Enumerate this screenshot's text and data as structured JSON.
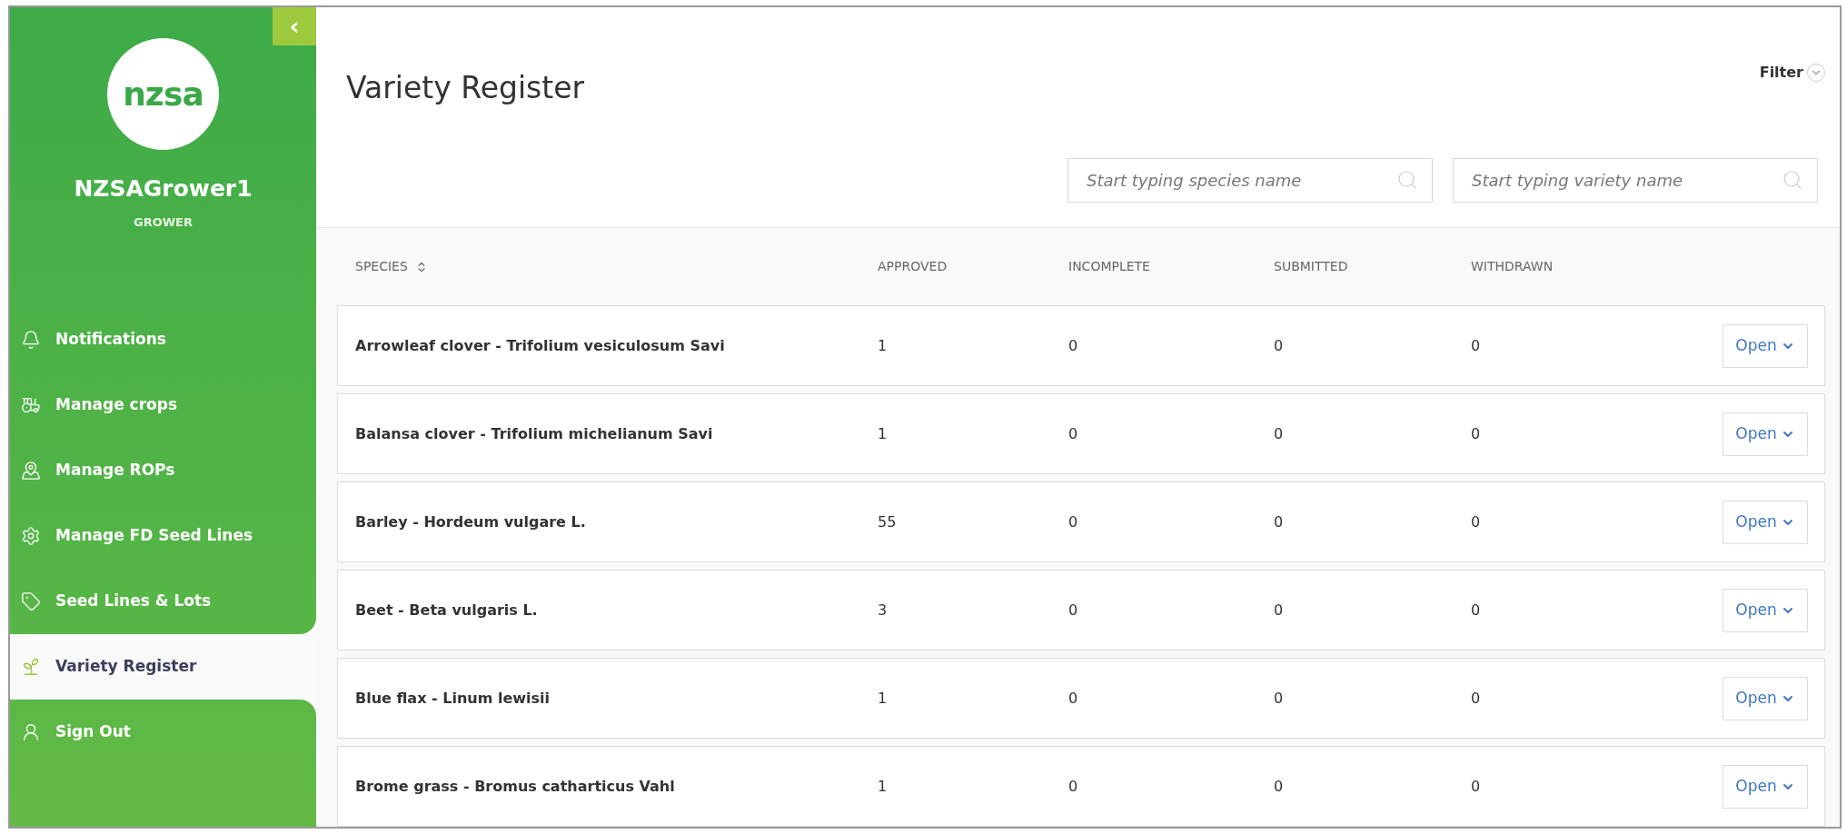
{
  "sidebar": {
    "logo_text": "nzsa",
    "user_name": "NZSAGrower1",
    "role": "GROWER",
    "collapse_glyph": "‹",
    "items": [
      {
        "label": "Notifications",
        "selected": false
      },
      {
        "label": "Manage crops",
        "selected": false
      },
      {
        "label": "Manage ROPs",
        "selected": false
      },
      {
        "label": "Manage FD Seed Lines",
        "selected": false
      },
      {
        "label": "Seed Lines & Lots",
        "selected": false
      },
      {
        "label": "Variety Register",
        "selected": true
      },
      {
        "label": "Sign Out",
        "selected": false
      }
    ]
  },
  "page": {
    "title": "Variety Register",
    "filter": "Filter",
    "searches": [
      {
        "placeholder": "Start typing species name"
      },
      {
        "placeholder": "Start typing variety name"
      }
    ]
  },
  "table": {
    "columns": [
      "SPECIES",
      "APPROVED",
      "INCOMPLETE",
      "SUBMITTED",
      "WITHDRAWN"
    ],
    "rows": [
      {
        "species": "Arrowleaf clover - Trifolium vesiculosum Savi",
        "approved": "1",
        "incomplete": "0",
        "submitted": "0",
        "withdrawn": "0",
        "action": "Open"
      },
      {
        "species": "Balansa clover - Trifolium michelianum Savi",
        "approved": "1",
        "incomplete": "0",
        "submitted": "0",
        "withdrawn": "0",
        "action": "Open"
      },
      {
        "species": "Barley - Hordeum vulgare L.",
        "approved": "55",
        "incomplete": "0",
        "submitted": "0",
        "withdrawn": "0",
        "action": "Open"
      },
      {
        "species": "Beet - Beta vulgaris L.",
        "approved": "3",
        "incomplete": "0",
        "submitted": "0",
        "withdrawn": "0",
        "action": "Open"
      },
      {
        "species": "Blue flax - Linum lewisii",
        "approved": "1",
        "incomplete": "0",
        "submitted": "0",
        "withdrawn": "0",
        "action": "Open"
      },
      {
        "species": "Brome grass - Bromus catharticus Vahl",
        "approved": "1",
        "incomplete": "0",
        "submitted": "0",
        "withdrawn": "0",
        "action": "Open"
      }
    ]
  }
}
